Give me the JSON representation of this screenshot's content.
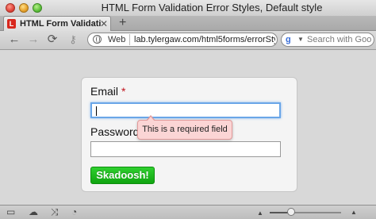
{
  "window": {
    "title": "HTML Form Validation Error Styles, Default style"
  },
  "tabs": [
    {
      "label": "HTML Form Validati",
      "favicon": "L",
      "active": true
    }
  ],
  "toolbar": {
    "back_icon": "←",
    "forward_icon": "→",
    "reload_icon": "⟳",
    "key_icon": "⚷",
    "address": {
      "mode": "Web",
      "url": "lab.tylergaw.com/html5forms/errorStyles/def"
    },
    "search": {
      "engine_glyph": "g",
      "placeholder": "Search with Goo"
    }
  },
  "form": {
    "email_label": "Email",
    "required_marker": "*",
    "password_label": "Password",
    "email_value": "",
    "password_value": "",
    "submit_label": "Skadoosh!",
    "error_tooltip": "This is a required field"
  },
  "statusbar": {
    "zoom_level": 0.3
  },
  "colors": {
    "submit_green": "#19b319",
    "focus_blue": "#6aa6e8",
    "tooltip_bg": "#fbd5d5",
    "required_red": "#c0141e"
  }
}
